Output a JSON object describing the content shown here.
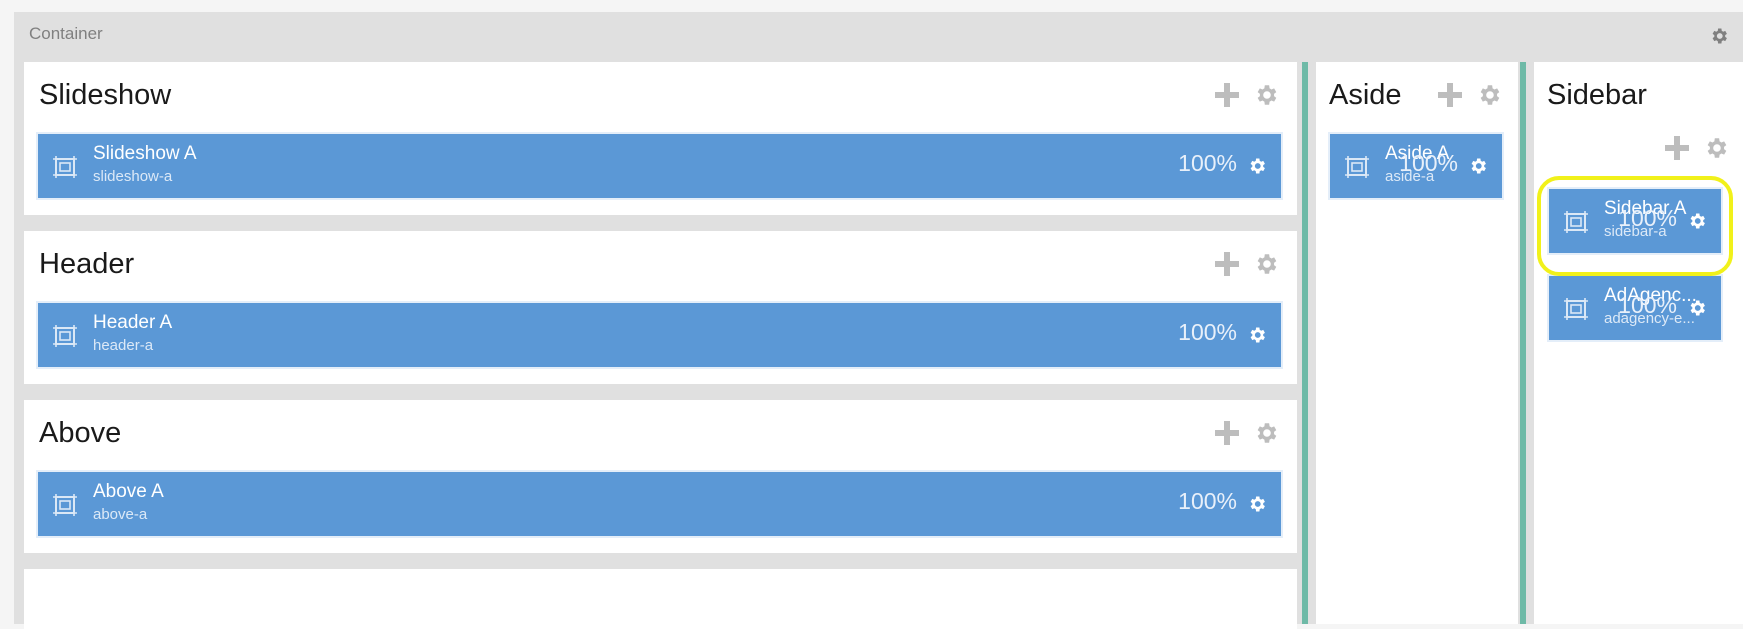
{
  "container": {
    "title": "Container"
  },
  "columns": {
    "main": {
      "sections": [
        {
          "title": "Slideshow",
          "block": {
            "title": "Slideshow A",
            "sub": "slideshow-a",
            "pct": "100%"
          }
        },
        {
          "title": "Header",
          "block": {
            "title": "Header A",
            "sub": "header-a",
            "pct": "100%"
          }
        },
        {
          "title": "Above",
          "block": {
            "title": "Above A",
            "sub": "above-a",
            "pct": "100%"
          }
        }
      ]
    },
    "aside": {
      "title": "Aside",
      "blocks": [
        {
          "title": "Aside A",
          "sub": "aside-a",
          "pct": "100%"
        }
      ]
    },
    "sidebar": {
      "title": "Sidebar",
      "blocks": [
        {
          "title": "Sidebar A",
          "sub": "sidebar-a",
          "pct": "100%"
        },
        {
          "title": "AdAgenc...",
          "sub": "adagency-e...",
          "pct": "100%"
        }
      ]
    }
  },
  "colors": {
    "block": "#5b98d6",
    "divider": "#6ebaa7",
    "highlight": "#f1f11a"
  }
}
